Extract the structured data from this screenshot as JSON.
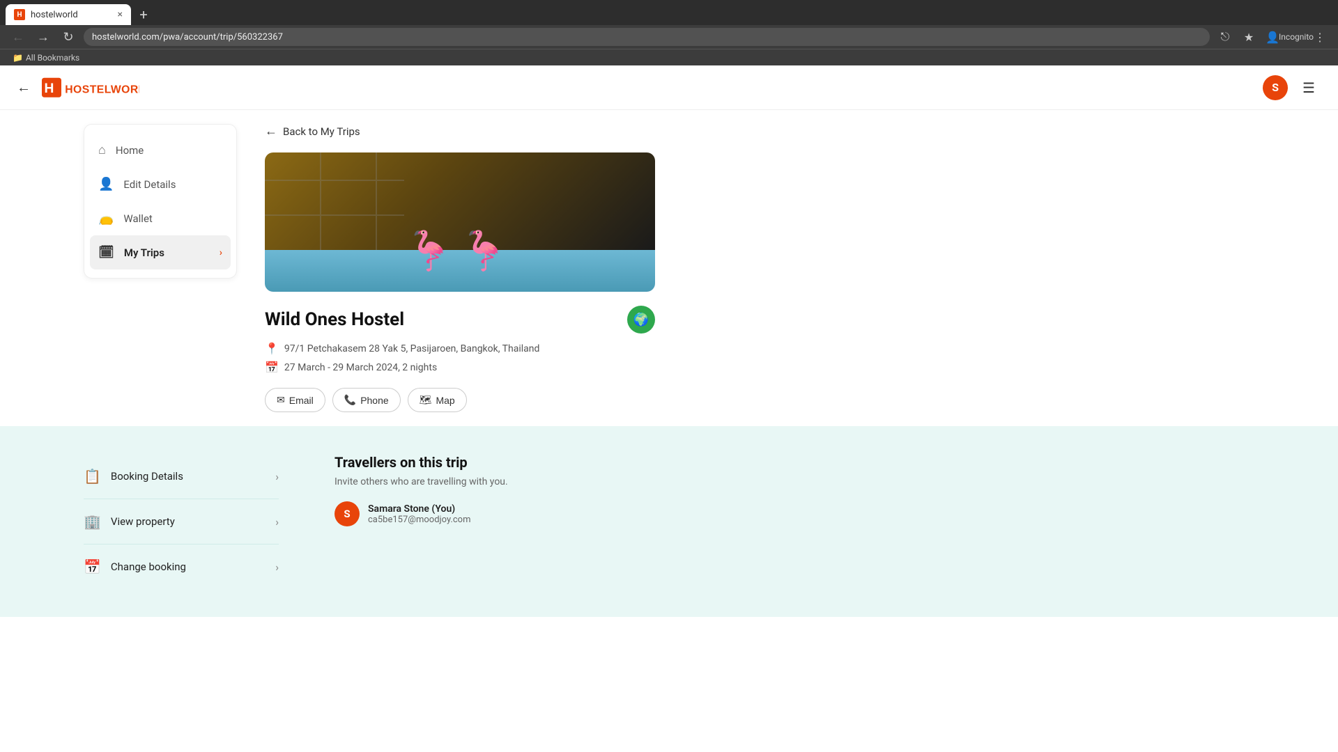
{
  "browser": {
    "tab": {
      "favicon": "H",
      "title": "hostelworld",
      "close": "×"
    },
    "new_tab": "+",
    "url": "hostelworld.com/pwa/account/trip/560322367",
    "nav": {
      "back": "←",
      "forward": "→",
      "refresh": "↻"
    },
    "bookmarks_label": "All Bookmarks"
  },
  "header": {
    "back_arrow": "←",
    "logo_text": "HOSTELWORLD",
    "avatar_initial": "S",
    "menu_icon": "☰"
  },
  "sidebar": {
    "items": [
      {
        "id": "home",
        "label": "Home",
        "icon": "⌂",
        "active": false
      },
      {
        "id": "edit-details",
        "label": "Edit Details",
        "icon": "👤",
        "active": false
      },
      {
        "id": "wallet",
        "label": "Wallet",
        "icon": "👝",
        "active": false
      },
      {
        "id": "my-trips",
        "label": "My Trips",
        "icon": "🗓",
        "active": true
      }
    ]
  },
  "trip": {
    "back_label": "Back to My Trips",
    "back_arrow": "←",
    "hostel_name": "Wild Ones Hostel",
    "address": "97/1 Petchakasem 28 Yak 5, Pasijaroen, Bangkok, Thailand",
    "dates": "27 March - 29 March 2024, 2 nights",
    "contact_buttons": [
      {
        "id": "email",
        "label": "Email",
        "icon": "✉"
      },
      {
        "id": "phone",
        "label": "Phone",
        "icon": "📞"
      },
      {
        "id": "map",
        "label": "Map",
        "icon": "🗺"
      }
    ]
  },
  "actions": [
    {
      "id": "booking-details",
      "label": "Booking Details",
      "icon": "📋"
    },
    {
      "id": "view-property",
      "label": "View property",
      "icon": "🏢"
    },
    {
      "id": "change-booking",
      "label": "Change booking",
      "icon": "📅"
    }
  ],
  "travellers": {
    "title": "Travellers on this trip",
    "description": "Invite others who are travelling with you.",
    "list": [
      {
        "name": "Samara Stone (You)",
        "email": "ca5be157@moodjoy.com",
        "initial": "S"
      }
    ]
  }
}
